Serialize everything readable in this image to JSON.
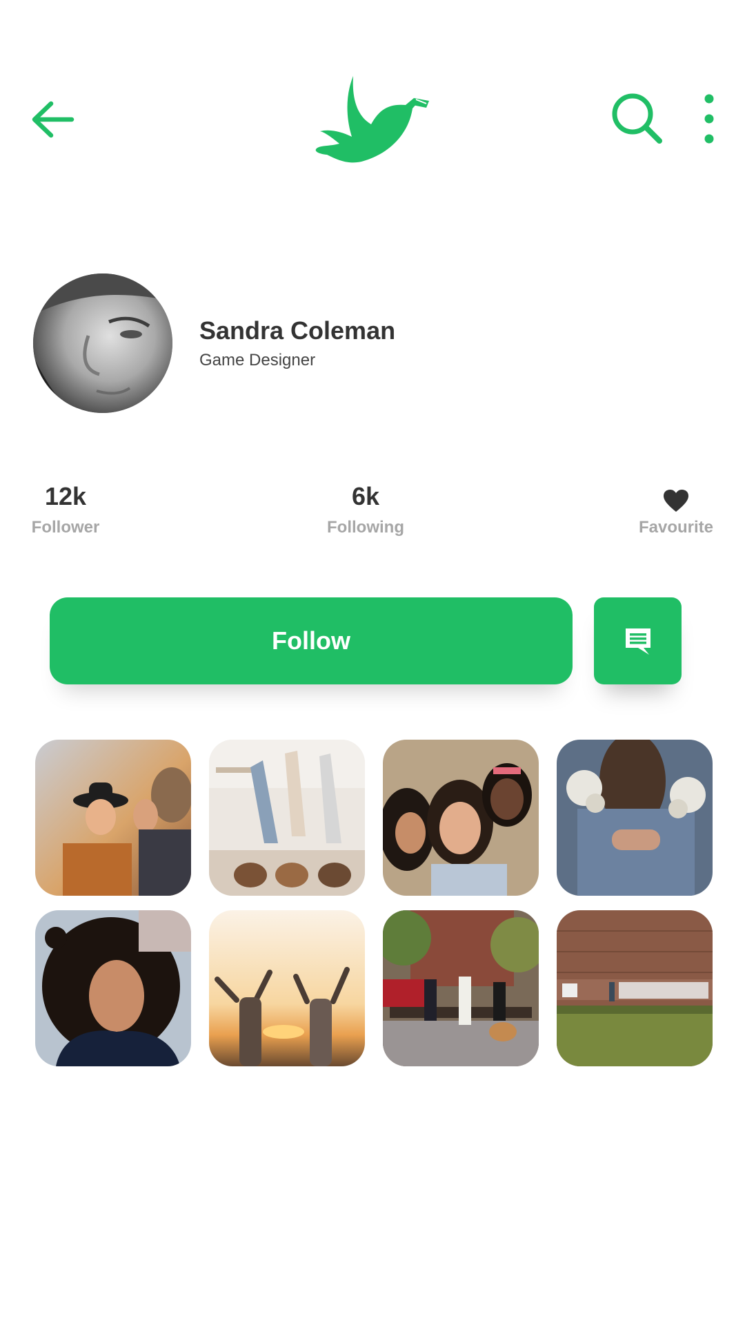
{
  "colors": {
    "accent": "#20be65",
    "text": "#333333",
    "muted": "#a6a6a6"
  },
  "header": {
    "back_icon": "arrow-left-icon",
    "logo_icon": "dove-logo-icon",
    "search_icon": "search-icon",
    "more_icon": "more-vertical-icon"
  },
  "profile": {
    "name": "Sandra Coleman",
    "role": "Game Designer"
  },
  "stats": {
    "followers": {
      "value": "12k",
      "label": "Follower"
    },
    "following": {
      "value": "6k",
      "label": "Following"
    },
    "favourite": {
      "icon": "heart-icon",
      "label": "Favourite"
    }
  },
  "actions": {
    "follow_label": "Follow",
    "message_icon": "message-icon"
  },
  "photos": [
    {
      "name": "friends-laughing-photo"
    },
    {
      "name": "women-lying-bed-photo"
    },
    {
      "name": "three-women-selfie-photo"
    },
    {
      "name": "flowers-embrace-photo"
    },
    {
      "name": "curly-hair-portrait-photo"
    },
    {
      "name": "sunset-celebration-photo"
    },
    {
      "name": "bench-group-dog-photo"
    },
    {
      "name": "brick-wall-mural-photo"
    }
  ]
}
